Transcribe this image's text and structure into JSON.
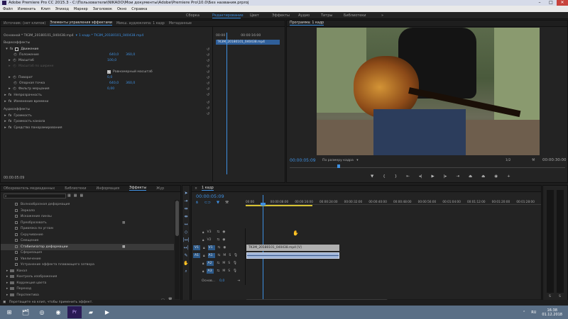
{
  "title_bar": {
    "title": "Adobe Premiere Pro CC 2015.3 - C:\\Пользователи\\NIKADO\\Мои документы\\Adobe\\Premiere Pro\\10.0\\Без названия.prproj"
  },
  "menu": [
    "Файл",
    "Изменить",
    "Клип",
    "Эпизод",
    "Маркер",
    "Заголовок",
    "Окно",
    "Справка"
  ],
  "workspaces": [
    "Сборка",
    "Редактирование",
    "Цвет",
    "Эффекты",
    "Аудио",
    "Титры",
    "Библиотеки",
    "»"
  ],
  "workspace_active": "Редактирование",
  "source_panel": {
    "tabs": [
      "Источник: (нет клипов)",
      "Элементы управления эффектами",
      "Микш. аудиоклипа: 1 кадр",
      "Метаданные"
    ],
    "active_tab": "Элементы управления эффектами",
    "header_left": "Основной * TK3M_20180101_040438.mp4",
    "header_right": "1 кадр * TK3M_20180101_040438.mp4",
    "timecode_start": "00:00",
    "timecode_mid": "00:00:16:00",
    "clip_label": "TK3M_20180101_040438.mp4",
    "video_effects_label": "Видеоэффекты",
    "motion": "Движение",
    "position_label": "Положение",
    "position_x": "640,0",
    "position_y": "360,0",
    "scale_label": "Масштаб",
    "scale_value": "100,0",
    "scale_width_label": "Масштаб по ширине",
    "uniform_scale_label": "Равномерный масштаб",
    "rotation_label": "Поворот",
    "rotation_value": "0,0",
    "anchor_label": "Опорная точка",
    "anchor_x": "640,0",
    "anchor_y": "360,0",
    "antiflicker_label": "Фильтр мерцания",
    "antiflicker_value": "0,00",
    "opacity_label": "Непрозрачность",
    "time_remap_label": "Изменение времени",
    "audio_effects_label": "Аудиоэффекты",
    "volume_label": "Громкость",
    "channel_volume_label": "Громкость канала",
    "panner_label": "Средство панорамирования",
    "bottom_timecode": "00:00:05:09"
  },
  "program_panel": {
    "tab": "Программа: 1 кадр",
    "timecode": "00:00:05:09",
    "fit": "По размеру кадра",
    "ratio": "1/2",
    "duration": "00:00:30:00"
  },
  "effects_panel": {
    "tabs": [
      "Обозреватель медиаданных",
      "Библиотеки",
      "Информация",
      "Эффекты",
      "Жур"
    ],
    "active_tab": "Эффекты",
    "items": [
      "Волнообразная деформация",
      "Зеркало",
      "Искажение линзы",
      "Преобразовать",
      "Привязка по углам",
      "Скручивание",
      "Смещение",
      "Стабилизатор деформации",
      "Сферизация",
      "Увеличение",
      "Устранение эффекта плавающего затвора"
    ],
    "selected": "Стабилизатор деформации",
    "folders": [
      "Канал",
      "Контроль изображения",
      "Коррекция цвета",
      "Переход",
      "Перспектива"
    ]
  },
  "timeline": {
    "tab": "1 кадр",
    "timecode": "00:00:05:09",
    "ruler": [
      "00:00",
      "00:00:08:00",
      "00:00:16:00",
      "00:00:24:00",
      "00:00:32:00",
      "00:00:40:00",
      "00:00:48:00",
      "00:00:56:00",
      "00:01:04:00",
      "00:01:12:00",
      "00:01:20:00",
      "00:01:28:00"
    ],
    "tracks": [
      "V3",
      "V2",
      "V1",
      "A1",
      "A2",
      "A3"
    ],
    "source_patch_v": "V1",
    "source_patch_a": "A1",
    "master_label": "Основ...",
    "master_value": "0,0",
    "video_clip_label": "TK3M_20180101_040438.mp4 [V]"
  },
  "meters": {
    "labels": [
      "S",
      "S"
    ]
  },
  "status_bar": {
    "text": "Перетащите на клип, чтобы применить эффект."
  },
  "taskbar": {
    "lang": "RU",
    "time": "16:38",
    "date": "01.12.2018"
  }
}
